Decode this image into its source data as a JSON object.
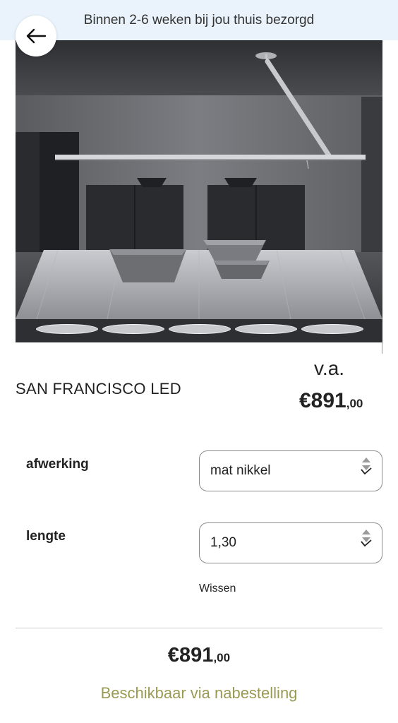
{
  "banner": {
    "text": "Binnen 2-6 weken bij jou thuis bezorgd"
  },
  "product": {
    "name": "SAN FRANCISCO LED",
    "price_prefix": "v.a.",
    "price_main": "€891",
    "price_cents": ",00"
  },
  "options": [
    {
      "label": "afwerking",
      "value": "mat nikkel"
    },
    {
      "label": "lengte",
      "value": "1,30"
    }
  ],
  "clear_label": "Wissen",
  "total": {
    "main": "€891",
    "cents": ",00"
  },
  "availability": "Beschikbaar via nabestelling",
  "colors": {
    "banner_bg": "#eaf3fb",
    "availability": "#9a9a55"
  },
  "gallery": {
    "slides": 5,
    "active": 1
  }
}
